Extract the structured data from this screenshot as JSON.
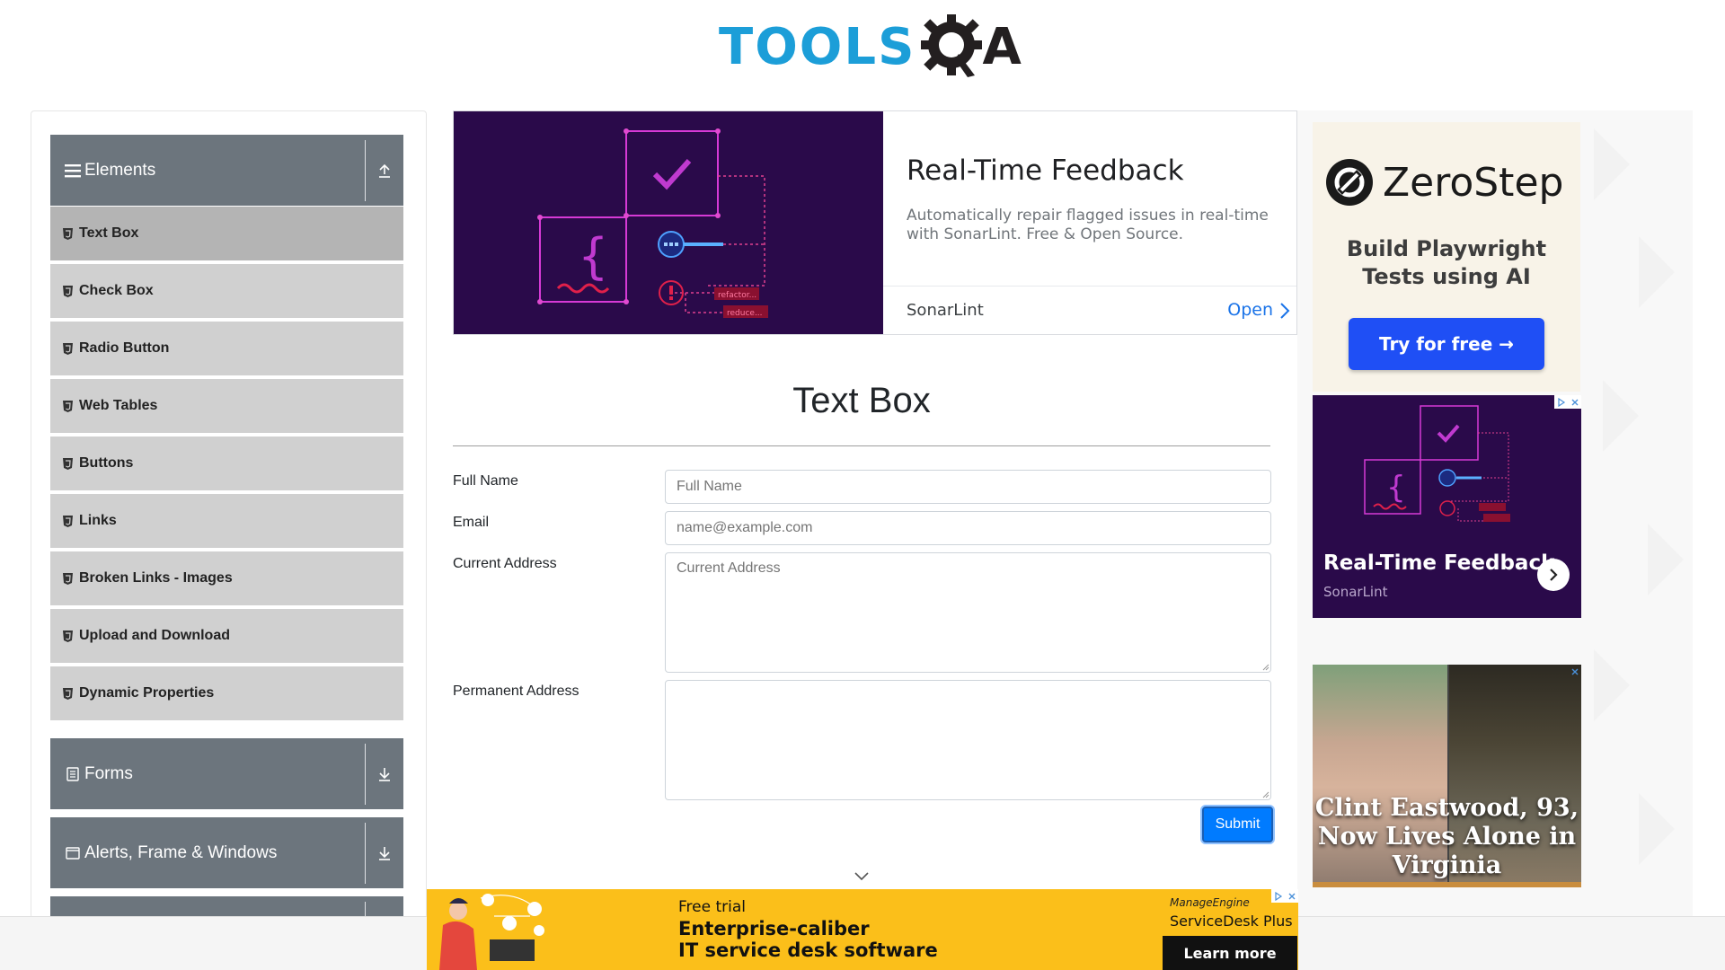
{
  "header": {
    "logo_text": "TOOLS",
    "logo_suffix": "A",
    "logo_alt": "TOOLSQA"
  },
  "sidebar": {
    "groups": [
      {
        "title": "Elements",
        "icon": "hamburger-icon",
        "arrow": "collapse-up-icon",
        "expanded": true
      },
      {
        "title": "Forms",
        "icon": "document-icon",
        "arrow": "expand-down-icon",
        "expanded": false
      },
      {
        "title": "Alerts, Frame & Windows",
        "icon": "window-icon",
        "arrow": "expand-down-icon",
        "expanded": false
      }
    ],
    "items": [
      {
        "label": "Text Box",
        "active": true
      },
      {
        "label": "Check Box"
      },
      {
        "label": "Radio Button"
      },
      {
        "label": "Web Tables"
      },
      {
        "label": "Buttons"
      },
      {
        "label": "Links"
      },
      {
        "label": "Broken Links - Images"
      },
      {
        "label": "Upload and Download"
      },
      {
        "label": "Dynamic Properties"
      }
    ]
  },
  "top_ad": {
    "title": "Real-Time Feedback",
    "description": "Automatically repair flagged issues in real-time with SonarLint. Free & Open Source.",
    "brand": "SonarLint",
    "cta": "Open",
    "tag_refactor": "refactor...",
    "tag_reduce": "reduce..."
  },
  "form": {
    "title": "Text Box",
    "full_name_label": "Full Name",
    "full_name_placeholder": "Full Name",
    "email_label": "Email",
    "email_placeholder": "name@example.com",
    "current_address_label": "Current Address",
    "current_address_placeholder": "Current Address",
    "permanent_address_label": "Permanent Address",
    "submit_label": "Submit"
  },
  "right_ads": {
    "zerostep": {
      "brand": "ZeroStep",
      "tagline_1": "Build Playwright",
      "tagline_2": "Tests using AI",
      "cta": "Try for free →"
    },
    "sonarlint": {
      "title": "Real-Time Feedback",
      "brand": "SonarLint"
    },
    "news": {
      "headline": "Clint Eastwood, 93, Now Lives Alone in Virginia"
    }
  },
  "bottom_ad": {
    "small": "Free trial",
    "line1": "Enterprise-caliber",
    "line2": "IT service desk software",
    "brand_small": "ManageEngine",
    "brand_product": "ServiceDesk Plus",
    "cta": "Learn more"
  },
  "colors": {
    "logo_blue": "#1c9ed8",
    "sidebar_header": "#6c757d",
    "sidebar_item": "#d0d0d0",
    "sidebar_item_active": "#b4b4b4",
    "submit_blue": "#007bff",
    "ad_purple": "#2a0a4a",
    "ad_yellow": "#fbbf1a"
  }
}
